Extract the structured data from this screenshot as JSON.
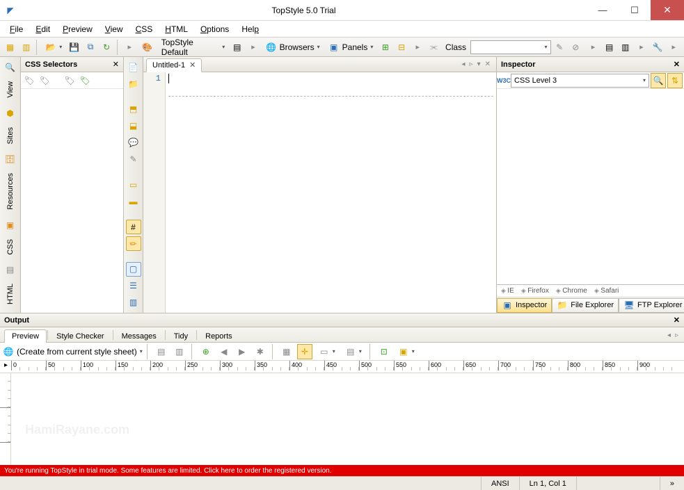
{
  "window": {
    "title": "TopStyle 5.0 Trial"
  },
  "menu": {
    "file": "File",
    "edit": "Edit",
    "preview": "Preview",
    "view": "View",
    "css": "CSS",
    "html": "HTML",
    "options": "Options",
    "help": "Help"
  },
  "toolbar": {
    "theme_label": "TopStyle Default",
    "browsers_label": "Browsers",
    "panels_label": "Panels",
    "class_label": "Class",
    "class_value": ""
  },
  "sidebar": {
    "tabs": [
      "View",
      "Sites",
      "Resources",
      "CSS",
      "HTML"
    ]
  },
  "selectors": {
    "title": "CSS Selectors"
  },
  "editor": {
    "tabs": [
      {
        "name": "Untitled-1"
      }
    ],
    "line_number": "1"
  },
  "inspector": {
    "title": "Inspector",
    "spec_combo": "CSS Level 3",
    "spec_prefix": "W3C",
    "browsers": [
      "IE",
      "Firefox",
      "Chrome",
      "Safari"
    ],
    "bottom_tabs": [
      "Inspector",
      "File Explorer",
      "FTP Explorer"
    ]
  },
  "output": {
    "title": "Output",
    "tabs": [
      "Preview",
      "Style Checker",
      "Messages",
      "Tidy",
      "Reports"
    ],
    "create_label": "(Create from current style sheet)"
  },
  "ruler": {
    "ticks": [
      0,
      50,
      100,
      150,
      200,
      250,
      300,
      350,
      400,
      450,
      500,
      550,
      600,
      650,
      700,
      750,
      800,
      850,
      900
    ]
  },
  "trial": {
    "message": "You're running TopStyle in trial mode. Some features are limited. Click here to order the registered version."
  },
  "status": {
    "encoding": "ANSI",
    "position": "Ln 1, Col 1",
    "chevron": "»"
  },
  "watermark": "HamiRayane.com"
}
